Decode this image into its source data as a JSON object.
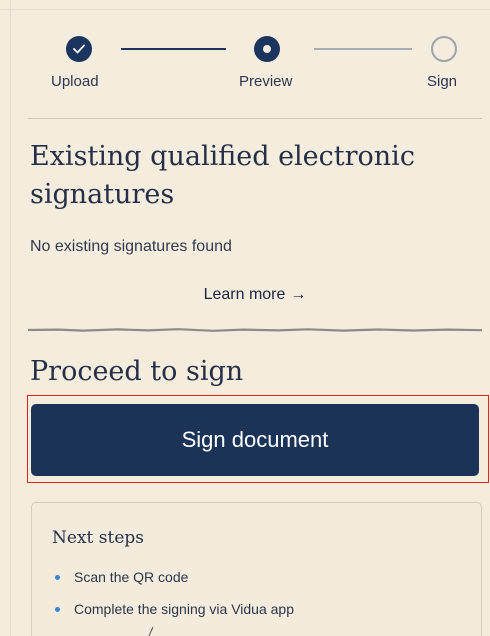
{
  "stepper": {
    "steps": [
      {
        "label": "Upload",
        "state": "done"
      },
      {
        "label": "Preview",
        "state": "current"
      },
      {
        "label": "Sign",
        "state": "todo"
      }
    ]
  },
  "existing": {
    "heading": "Existing qualified electronic signatures",
    "empty_text": "No existing signatures found",
    "learn_more": "Learn more",
    "learn_more_arrow": "→"
  },
  "proceed": {
    "heading": "Proceed to sign",
    "button_label": "Sign document"
  },
  "next_steps": {
    "title": "Next steps",
    "items": [
      "Scan the QR code",
      "Complete the signing via Vidua app"
    ]
  },
  "colors": {
    "background": "#f4ecdd",
    "primary": "#1c3358",
    "bullet": "#3d82d4",
    "highlight": "#e0241b"
  }
}
